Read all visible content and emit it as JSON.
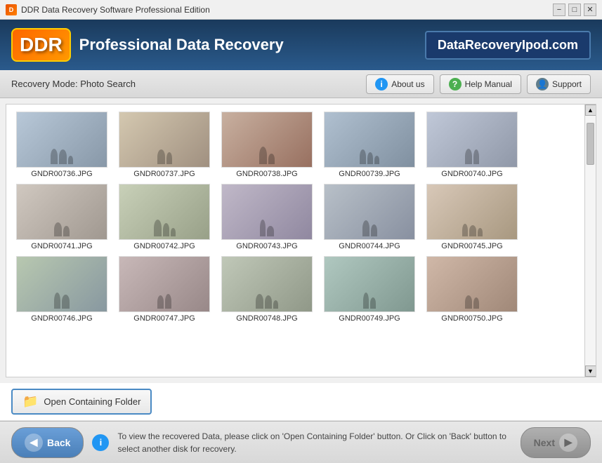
{
  "titlebar": {
    "title": "DDR Data Recovery Software Professional Edition",
    "controls": [
      "minimize",
      "maximize",
      "close"
    ]
  },
  "header": {
    "logo": "DDR",
    "tagline": "Professional Data Recovery",
    "domain": "DataRecoveryIpod.com"
  },
  "navbar": {
    "recovery_mode": "Recovery Mode: Photo Search",
    "about_btn": "About us",
    "help_btn": "Help Manual",
    "support_btn": "Support"
  },
  "photos": [
    {
      "name": "GNDR00736.JPG",
      "thumb_class": "t1"
    },
    {
      "name": "GNDR00737.JPG",
      "thumb_class": "t2"
    },
    {
      "name": "GNDR00738.JPG",
      "thumb_class": "t3"
    },
    {
      "name": "GNDR00739.JPG",
      "thumb_class": "t4"
    },
    {
      "name": "GNDR00740.JPG",
      "thumb_class": "t5"
    },
    {
      "name": "GNDR00741.JPG",
      "thumb_class": "t6"
    },
    {
      "name": "GNDR00742.JPG",
      "thumb_class": "t7"
    },
    {
      "name": "GNDR00743.JPG",
      "thumb_class": "t8"
    },
    {
      "name": "GNDR00744.JPG",
      "thumb_class": "t9"
    },
    {
      "name": "GNDR00745.JPG",
      "thumb_class": "t10"
    },
    {
      "name": "GNDR00746.JPG",
      "thumb_class": "t11"
    },
    {
      "name": "GNDR00747.JPG",
      "thumb_class": "t12"
    },
    {
      "name": "GNDR00748.JPG",
      "thumb_class": "t13"
    },
    {
      "name": "GNDR00749.JPG",
      "thumb_class": "t14"
    },
    {
      "name": "GNDR00750.JPG",
      "thumb_class": "t15"
    }
  ],
  "folder_btn": "Open Containing Folder",
  "bottom": {
    "back_label": "Back",
    "next_label": "Next",
    "info_text": "To view the recovered Data, please click on 'Open Containing Folder' button. Or\nClick on 'Back' button to select another disk for recovery."
  }
}
